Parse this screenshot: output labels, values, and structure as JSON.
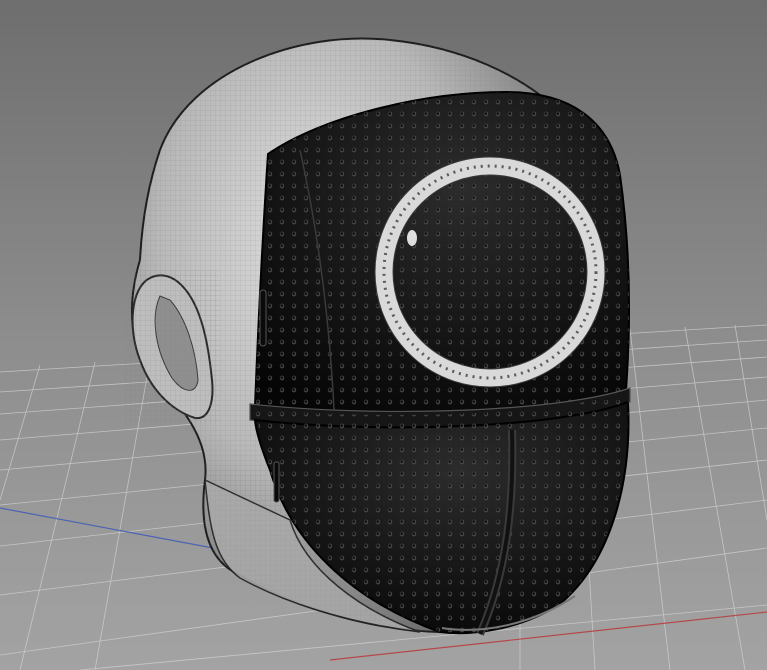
{
  "scene": {
    "subject": "3d-head-with-mask",
    "colors": {
      "sky_top": "#6f6f6f",
      "sky_bottom": "#9a9a9a",
      "grid_line": "#d6d6d6",
      "axis_red": "#b5484a",
      "axis_blue": "#4a63b3",
      "head_skin": "#b9b9b9",
      "mask_black": "#1a1a1a",
      "ring_white": "#d9d9d9"
    }
  }
}
